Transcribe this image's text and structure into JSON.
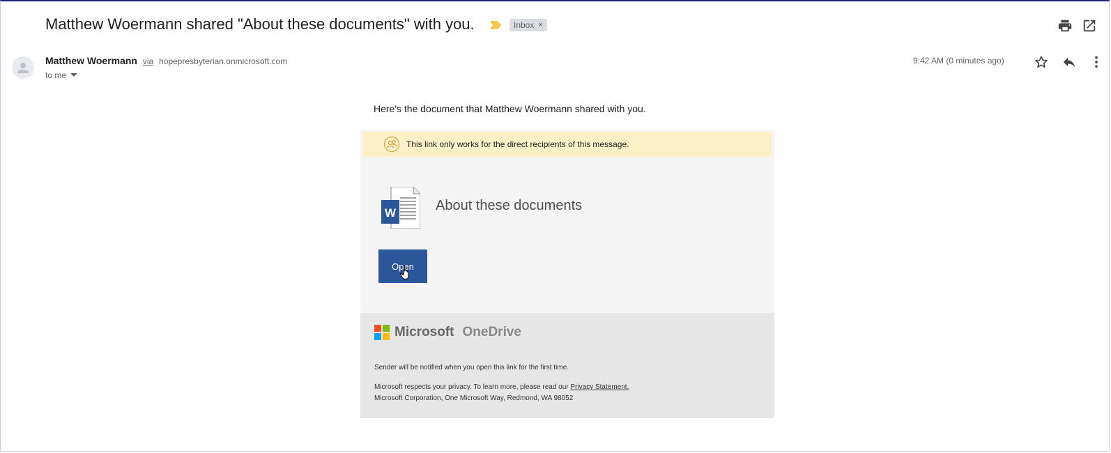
{
  "subject": "Matthew Woermann shared \"About these documents\" with you.",
  "label": {
    "text": "Inbox",
    "close": "×"
  },
  "sender": {
    "name": "Matthew Woermann",
    "via": "via",
    "domain": "hopepresbyterian.onmicrosoft.com",
    "to": "to me"
  },
  "timestamp": "9:42 AM (0 minutes ago)",
  "icons": {
    "print": "print-icon",
    "popout": "open-in-new-window-icon",
    "star": "star-icon",
    "reply": "reply-icon",
    "more": "more-vert-icon",
    "important": "important-marker-icon",
    "avatar": "person-icon"
  },
  "body": {
    "intro": "Here's the document that Matthew Woermann shared with you.",
    "notice": "This link only works for the direct recipients of this message.",
    "doc_title": "About these documents",
    "open_label": "Open",
    "brand_microsoft": "Microsoft",
    "brand_onedrive": "OneDrive",
    "footer_notify": "Sender will be notified when you open this link for the first time.",
    "footer_privacy_prefix": "Microsoft respects your privacy. To learn more, please read our",
    "footer_privacy_link": "Privacy Statement.",
    "footer_address": "Microsoft Corporation, One Microsoft Way, Redmond, WA 98052"
  },
  "colors": {
    "open_button": "#2b579a",
    "notice_bg": "#fcf1c6",
    "card_bg": "#f4f4f4",
    "footer_bg": "#e6e6e6",
    "important": "#f2c94c",
    "ms_red": "#f25022",
    "ms_green": "#7fba00",
    "ms_blue": "#00a4ef",
    "ms_yellow": "#ffb900"
  }
}
